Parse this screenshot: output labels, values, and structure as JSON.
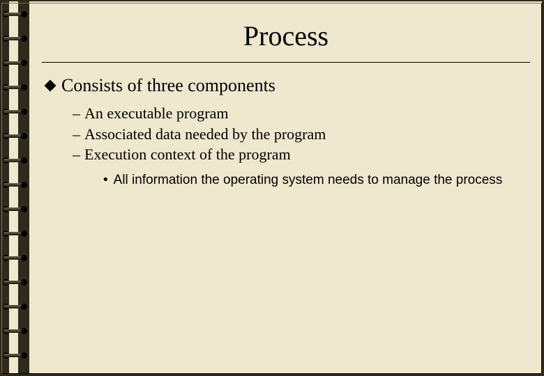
{
  "title": "Process",
  "bullet1": "Consists of three components",
  "sub": {
    "dash": "–",
    "items": [
      "An executable program",
      "Associated data needed by the program",
      "Execution context of the program"
    ]
  },
  "subsub": {
    "dot": "•",
    "item": "All information the operating system needs to manage the process"
  }
}
